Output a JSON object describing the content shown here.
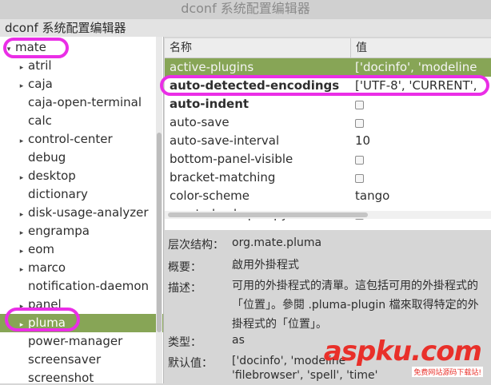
{
  "window": {
    "title": "dconf 系统配置编辑器"
  },
  "menubar": {
    "title": "dconf 系统配置编辑器"
  },
  "tree": {
    "items": [
      {
        "label": "mate",
        "expanded": true,
        "arrow": "▾",
        "depth": 0,
        "selected": false
      },
      {
        "label": "atril",
        "arrow": "▸",
        "depth": 1,
        "selected": false
      },
      {
        "label": "caja",
        "arrow": "▸",
        "depth": 1,
        "selected": false
      },
      {
        "label": "caja-open-terminal",
        "arrow": "",
        "depth": 1,
        "selected": false
      },
      {
        "label": "calc",
        "arrow": "",
        "depth": 1,
        "selected": false
      },
      {
        "label": "control-center",
        "arrow": "▸",
        "depth": 1,
        "selected": false
      },
      {
        "label": "debug",
        "arrow": "",
        "depth": 1,
        "selected": false
      },
      {
        "label": "desktop",
        "arrow": "▸",
        "depth": 1,
        "selected": false
      },
      {
        "label": "dictionary",
        "arrow": "",
        "depth": 1,
        "selected": false
      },
      {
        "label": "disk-usage-analyzer",
        "arrow": "▸",
        "depth": 1,
        "selected": false
      },
      {
        "label": "engrampa",
        "arrow": "▸",
        "depth": 1,
        "selected": false
      },
      {
        "label": "eom",
        "arrow": "▸",
        "depth": 1,
        "selected": false
      },
      {
        "label": "marco",
        "arrow": "▸",
        "depth": 1,
        "selected": false
      },
      {
        "label": "notification-daemon",
        "arrow": "",
        "depth": 1,
        "selected": false
      },
      {
        "label": "panel",
        "arrow": "▸",
        "depth": 1,
        "selected": false
      },
      {
        "label": "pluma",
        "arrow": "▸",
        "depth": 1,
        "selected": true
      },
      {
        "label": "power-manager",
        "arrow": "",
        "depth": 1,
        "selected": false
      },
      {
        "label": "screensaver",
        "arrow": "",
        "depth": 1,
        "selected": false
      },
      {
        "label": "screenshot",
        "arrow": "",
        "depth": 1,
        "selected": false
      }
    ]
  },
  "table": {
    "headers": {
      "name": "名称",
      "value": "值"
    },
    "rows": [
      {
        "key": "active-plugins",
        "value": "['docinfo', 'modeline",
        "type": "text",
        "bold": false,
        "selected": true
      },
      {
        "key": "auto-detected-encodings",
        "value": "['UTF-8', 'CURRENT',",
        "type": "text",
        "bold": true,
        "selected": false
      },
      {
        "key": "auto-indent",
        "value": "",
        "type": "checkbox",
        "bold": true,
        "selected": false
      },
      {
        "key": "auto-save",
        "value": "",
        "type": "checkbox",
        "bold": false,
        "selected": false
      },
      {
        "key": "auto-save-interval",
        "value": "10",
        "type": "text",
        "bold": false,
        "selected": false
      },
      {
        "key": "bottom-panel-visible",
        "value": "",
        "type": "checkbox",
        "bold": false,
        "selected": false
      },
      {
        "key": "bracket-matching",
        "value": "",
        "type": "checkbox",
        "bold": false,
        "selected": false
      },
      {
        "key": "color-scheme",
        "value": "tango",
        "type": "text",
        "bold": false,
        "selected": false
      },
      {
        "key": "create-backup-copy",
        "value": "",
        "type": "checkbox",
        "bold": false,
        "selected": false
      }
    ]
  },
  "details": {
    "schema_label": "层次结构：",
    "schema_value": "org.mate.pluma",
    "summary_label": "概要：",
    "summary_value": "啟用外掛程式",
    "desc_label": "描述：",
    "desc_value": "可用的外掛程式的清單。這包括可用的外掛程式的「位置」。參閱 .pluma-plugin 檔來取得特定的外掛程式的「位置」。",
    "type_label": "类型：",
    "type_value": "as",
    "default_label": "默认值：",
    "default_value_line1": "['docinfo', 'modeline",
    "default_value_line2": "'filebrowser', 'spell', 'time'"
  },
  "watermark": {
    "text": "aspku.com",
    "sub": "免费网站源码下载站!"
  },
  "colors": {
    "selection": "#87a556",
    "highlight": "#ea2ee6",
    "watermark": "#e9302a"
  }
}
